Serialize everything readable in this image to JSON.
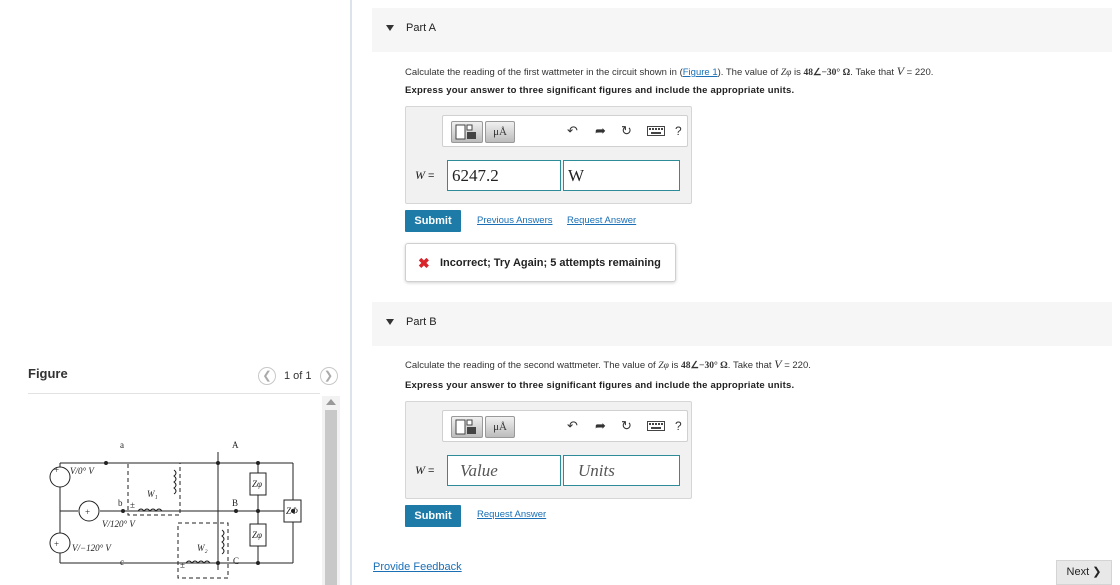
{
  "figure": {
    "title": "Figure",
    "count": "1 of 1",
    "labels": {
      "source_a": "V/0° V",
      "source_b": "V/120° V",
      "source_c": "V/−120° V",
      "node_a": "a",
      "node_b": "b",
      "node_c": "c",
      "node_A": "A",
      "node_B": "B",
      "node_C": "C",
      "wattmeter_1": "W₁",
      "wattmeter_2": "W₂",
      "impedance_phi": "Zφ",
      "impedance_delta": "ZΦ",
      "plus_minus": "±"
    }
  },
  "part_a": {
    "label": "Part A",
    "question_pre": "Calculate the reading of the first wattmeter in the circuit shown in (",
    "figure_link": "Figure 1",
    "question_mid": "). The value of ",
    "z_symbol": "Zφ",
    "question_is": " is ",
    "z_value": "48∠−30° Ω",
    "question_take": ". Take that ",
    "v_symbol": "V",
    "question_end": " = 220.",
    "instruction": "Express your answer to three significant figures and include the appropriate units.",
    "variable": "W",
    "equals": " = ",
    "value": "6247.2",
    "unit": "W",
    "submit": "Submit",
    "previous_answers": "Previous Answers",
    "request_answer": "Request Answer",
    "feedback": "Incorrect; Try Again; 5 attempts remaining"
  },
  "part_b": {
    "label": "Part B",
    "question_pre": "Calculate the reading of the second wattmeter. The value of ",
    "z_symbol": "Zφ",
    "question_is": " is ",
    "z_value": "48∠−30° Ω",
    "question_take": ". Take that ",
    "v_symbol": "V",
    "question_end": " = 220.",
    "instruction": "Express your answer to three significant figures and include the appropriate units.",
    "variable": "W",
    "equals": " = ",
    "value_placeholder": "Value",
    "unit_placeholder": "Units",
    "submit": "Submit",
    "request_answer": "Request Answer"
  },
  "toolbar": {
    "mu_label": "μÅ",
    "help": "?",
    "icons": [
      "templates-icon",
      "units-icon",
      "undo-icon",
      "redo-icon",
      "reset-icon",
      "keyboard-icon",
      "help-icon"
    ]
  },
  "footer": {
    "provide_feedback": "Provide Feedback",
    "next": "Next ❯"
  },
  "colors": {
    "submit_bg": "#1e7aa7",
    "link": "#1a6fb5",
    "field_border": "#2e8b98",
    "error_x": "#d9242b"
  }
}
